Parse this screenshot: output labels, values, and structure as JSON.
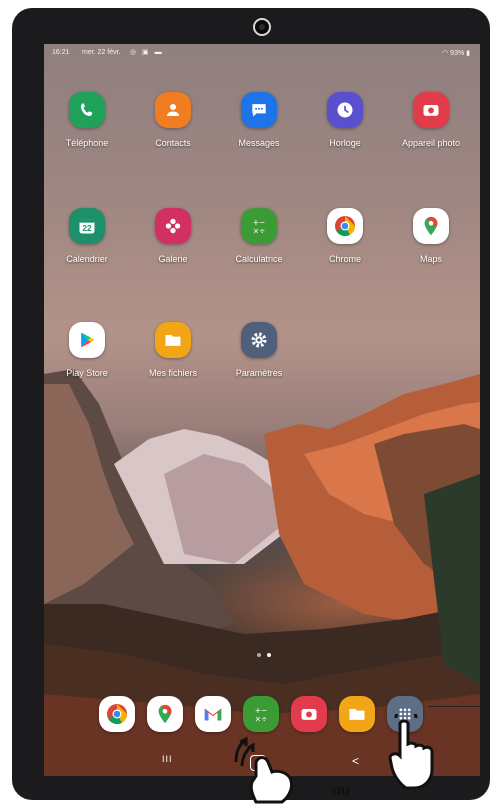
{
  "status_bar": {
    "time": "16:21",
    "date": "mer. 22 févr.",
    "battery": "93%"
  },
  "apps": [
    {
      "label": "Téléphone",
      "icon": "phone-icon",
      "color": "#1fa15a"
    },
    {
      "label": "Contacts",
      "icon": "contacts-icon",
      "color": "#f07d22"
    },
    {
      "label": "Messages",
      "icon": "messages-icon",
      "color": "#1e73e8"
    },
    {
      "label": "Horloge",
      "icon": "clock-icon",
      "color": "#5a4fcf"
    },
    {
      "label": "Appareil photo",
      "icon": "camera-icon",
      "color": "#e23b4b"
    },
    {
      "label": "Calendrier",
      "icon": "calendar-icon",
      "color": "#1d8f6a",
      "badge": "22"
    },
    {
      "label": "Galerie",
      "icon": "gallery-icon",
      "color": "#d22f63"
    },
    {
      "label": "Calculatrice",
      "icon": "calculator-icon",
      "color": "#3b9c36"
    },
    {
      "label": "Chrome",
      "icon": "chrome-icon",
      "color": "#ffffff"
    },
    {
      "label": "Maps",
      "icon": "maps-icon",
      "color": "#ffffff"
    },
    {
      "label": "Play Store",
      "icon": "play-store-icon",
      "color": "#ffffff"
    },
    {
      "label": "Mes fichiers",
      "icon": "files-icon",
      "color": "#f2a516"
    },
    {
      "label": "Paramètres",
      "icon": "settings-icon",
      "color": "#50607a"
    }
  ],
  "dock": [
    {
      "icon": "chrome-icon"
    },
    {
      "icon": "maps-icon"
    },
    {
      "icon": "gmail-icon"
    },
    {
      "icon": "calculator-icon"
    },
    {
      "icon": "camera-icon"
    },
    {
      "icon": "files-icon"
    },
    {
      "icon": "app-drawer-icon"
    }
  ],
  "nav": {
    "recents": "III",
    "back": "<"
  },
  "caption": {
    "or_word": "ou"
  }
}
